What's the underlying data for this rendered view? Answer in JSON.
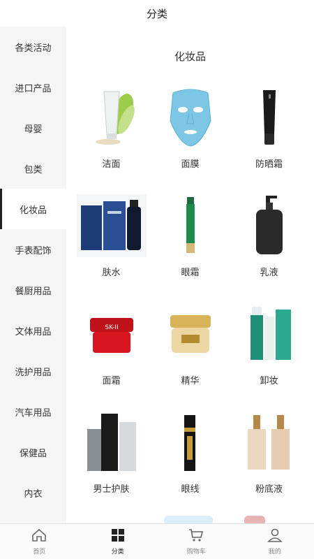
{
  "header": {
    "title": "分类"
  },
  "sidebar": {
    "items": [
      {
        "label": "各类活动"
      },
      {
        "label": "进口产品"
      },
      {
        "label": "母婴"
      },
      {
        "label": "包类"
      },
      {
        "label": "化妆品",
        "active": true
      },
      {
        "label": "手表配饰"
      },
      {
        "label": "餐厨用品"
      },
      {
        "label": "文体用品"
      },
      {
        "label": "洗护用品"
      },
      {
        "label": "汽车用品"
      },
      {
        "label": "保健品"
      },
      {
        "label": "内衣"
      }
    ]
  },
  "main": {
    "section_title": "化妆品",
    "products": [
      {
        "label": "洁面",
        "icon": "cleanser-tube-icon"
      },
      {
        "label": "面膜",
        "icon": "face-mask-icon"
      },
      {
        "label": "防晒霜",
        "icon": "sunscreen-tube-icon"
      },
      {
        "label": "肤水",
        "icon": "toner-bottle-icon"
      },
      {
        "label": "眼霜",
        "icon": "eye-cream-tube-icon"
      },
      {
        "label": "乳液",
        "icon": "lotion-pump-icon"
      },
      {
        "label": "面霜",
        "icon": "cream-jar-icon"
      },
      {
        "label": "精华",
        "icon": "essence-jar-icon"
      },
      {
        "label": "卸妆",
        "icon": "makeup-remover-icon"
      },
      {
        "label": "男士护肤",
        "icon": "mens-skincare-icon"
      },
      {
        "label": "眼线",
        "icon": "eyeliner-icon"
      },
      {
        "label": "粉底液",
        "icon": "foundation-bottle-icon"
      }
    ]
  },
  "tabbar": {
    "items": [
      {
        "label": "首页",
        "icon": "home-icon"
      },
      {
        "label": "分类",
        "icon": "category-grid-icon",
        "active": true
      },
      {
        "label": "购物车",
        "icon": "cart-icon"
      },
      {
        "label": "我的",
        "icon": "user-icon"
      }
    ]
  },
  "colors": {
    "sidebar_bg": "#f5f5f5",
    "active_indicator": "#222222",
    "tabbar_bg": "#fafafa"
  }
}
